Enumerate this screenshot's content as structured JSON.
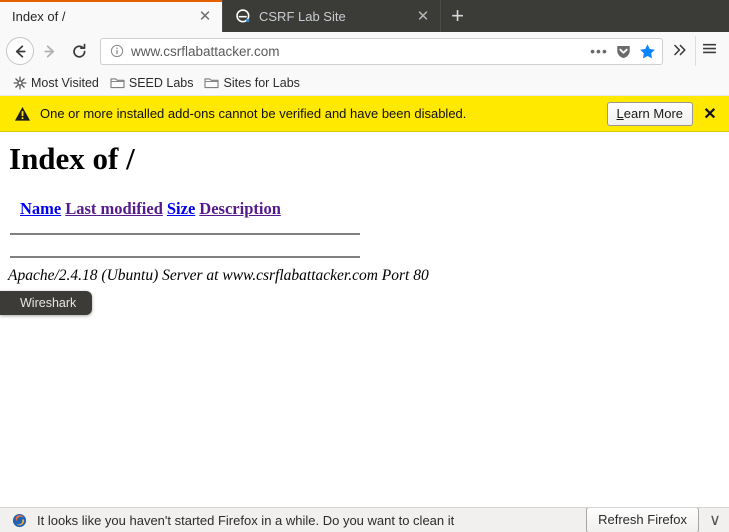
{
  "browser": {
    "tabs": [
      {
        "title": "Index of /",
        "active": true,
        "favicon": "none",
        "close_label": "✕"
      },
      {
        "title": "CSRF Lab Site",
        "active": false,
        "favicon": "elgg-icon",
        "close_label": "✕"
      }
    ],
    "new_tab_label": "+",
    "nav": {
      "back_icon": "back-arrow-icon",
      "forward_icon": "forward-arrow-icon",
      "reload_icon": "reload-icon",
      "identity_icon": "info-circle-icon",
      "url": "www.csrflabattacker.com",
      "url_placeholder": "Search or enter address",
      "page_actions_icon": "ellipsis-icon",
      "pocket_icon": "pocket-shield-icon",
      "bookmark_star_icon": "star-filled-icon",
      "bookmark_star_color": "#0a84ff",
      "overflow_icon": "double-chevron-right-icon",
      "menu_icon": "hamburger-menu-icon"
    },
    "bookmarks": [
      {
        "label": "Most Visited",
        "icon": "starburst-icon"
      },
      {
        "label": "SEED Labs",
        "icon": "folder-icon"
      },
      {
        "label": "Sites for Labs",
        "icon": "folder-icon"
      }
    ]
  },
  "addon_notification": {
    "warning_icon": "warning-triangle-icon",
    "message": "One or more installed add-ons cannot be verified and have been disabled.",
    "button_accesskey": "L",
    "button_label_rest": "earn More",
    "close_label": "✕",
    "background_color": "#ffe900"
  },
  "page": {
    "title": "Index of /",
    "columns": [
      {
        "label": "Name",
        "state": "unvisited"
      },
      {
        "label": "Last modified",
        "state": "visited"
      },
      {
        "label": "Size",
        "state": "unvisited"
      },
      {
        "label": "Description",
        "state": "visited"
      }
    ],
    "footer": "Apache/2.4.18 (Ubuntu) Server at www.csrflabattacker.com Port 80"
  },
  "tooltip": {
    "label": "Wireshark"
  },
  "refresh_notification": {
    "icon": "firefox-icon",
    "message": "It looks like you haven't started Firefox in a while. Do you want to clean it",
    "button_label": "Refresh Firefox",
    "close_label": "∨"
  }
}
